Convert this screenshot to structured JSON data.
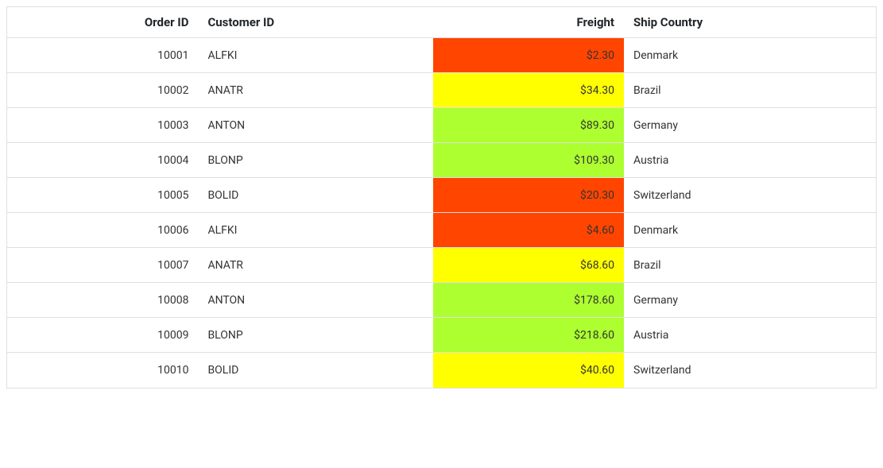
{
  "columns": {
    "orderId": "Order ID",
    "customerId": "Customer ID",
    "freight": "Freight",
    "shipCountry": "Ship Country"
  },
  "colors": {
    "lowFreight": "#ff4500",
    "midFreight": "#ffff00",
    "highFreight": "#adff2f",
    "border": "#e0e0e0"
  },
  "rows": [
    {
      "orderId": "10001",
      "customerId": "ALFKI",
      "freight": "$2.30",
      "freightValue": 2.3,
      "shipCountry": "Denmark"
    },
    {
      "orderId": "10002",
      "customerId": "ANATR",
      "freight": "$34.30",
      "freightValue": 34.3,
      "shipCountry": "Brazil"
    },
    {
      "orderId": "10003",
      "customerId": "ANTON",
      "freight": "$89.30",
      "freightValue": 89.3,
      "shipCountry": "Germany"
    },
    {
      "orderId": "10004",
      "customerId": "BLONP",
      "freight": "$109.30",
      "freightValue": 109.3,
      "shipCountry": "Austria"
    },
    {
      "orderId": "10005",
      "customerId": "BOLID",
      "freight": "$20.30",
      "freightValue": 20.3,
      "shipCountry": "Switzerland"
    },
    {
      "orderId": "10006",
      "customerId": "ALFKI",
      "freight": "$4.60",
      "freightValue": 4.6,
      "shipCountry": "Denmark"
    },
    {
      "orderId": "10007",
      "customerId": "ANATR",
      "freight": "$68.60",
      "freightValue": 68.6,
      "shipCountry": "Brazil"
    },
    {
      "orderId": "10008",
      "customerId": "ANTON",
      "freight": "$178.60",
      "freightValue": 178.6,
      "shipCountry": "Germany"
    },
    {
      "orderId": "10009",
      "customerId": "BLONP",
      "freight": "$218.60",
      "freightValue": 218.6,
      "shipCountry": "Austria"
    },
    {
      "orderId": "10010",
      "customerId": "BOLID",
      "freight": "$40.60",
      "freightValue": 40.6,
      "shipCountry": "Switzerland"
    }
  ],
  "chart_data": {
    "type": "table",
    "columns": [
      "Order ID",
      "Customer ID",
      "Freight",
      "Ship Country"
    ],
    "rows": [
      [
        "10001",
        "ALFKI",
        2.3,
        "Denmark"
      ],
      [
        "10002",
        "ANATR",
        34.3,
        "Brazil"
      ],
      [
        "10003",
        "ANTON",
        89.3,
        "Germany"
      ],
      [
        "10004",
        "BLONP",
        109.3,
        "Austria"
      ],
      [
        "10005",
        "BOLID",
        20.3,
        "Switzerland"
      ],
      [
        "10006",
        "ALFKI",
        4.6,
        "Denmark"
      ],
      [
        "10007",
        "ANATR",
        68.6,
        "Brazil"
      ],
      [
        "10008",
        "ANTON",
        178.6,
        "Germany"
      ],
      [
        "10009",
        "BLONP",
        218.6,
        "Austria"
      ],
      [
        "10010",
        "BOLID",
        40.6,
        "Switzerland"
      ]
    ]
  }
}
